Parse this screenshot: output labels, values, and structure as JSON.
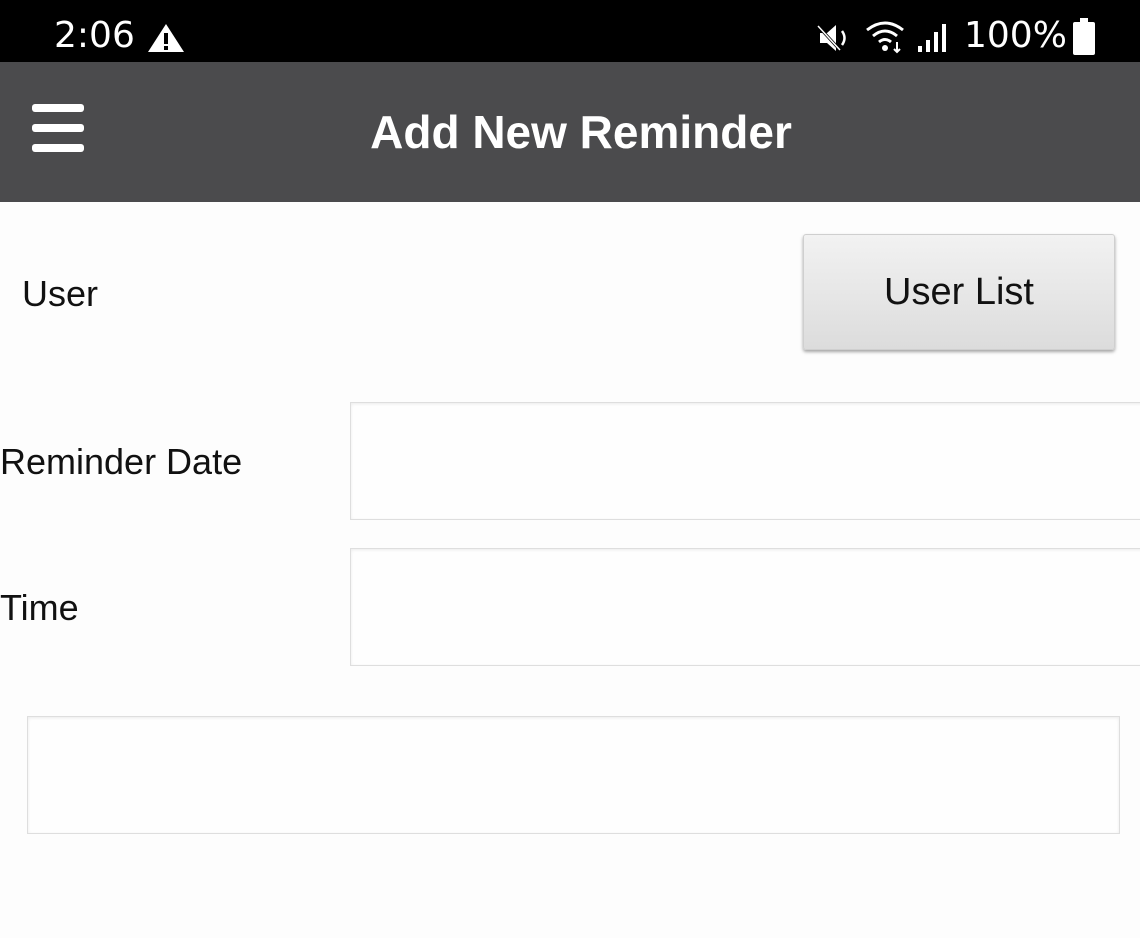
{
  "status_bar": {
    "time": "2:06",
    "battery_percent": "100%",
    "icons": [
      "warning-icon",
      "mute-icon",
      "wifi-icon",
      "signal-icon",
      "battery-icon"
    ]
  },
  "app_bar": {
    "title": "Add New Reminder",
    "menu_icon": "hamburger-menu-icon",
    "background_color": "#4b4b4d"
  },
  "form": {
    "user_label": "User",
    "user_list_button": "User List",
    "reminder_date_label": "Reminder Date",
    "reminder_date_value": "",
    "time_label": "Time",
    "time_value": "",
    "note_value": ""
  }
}
